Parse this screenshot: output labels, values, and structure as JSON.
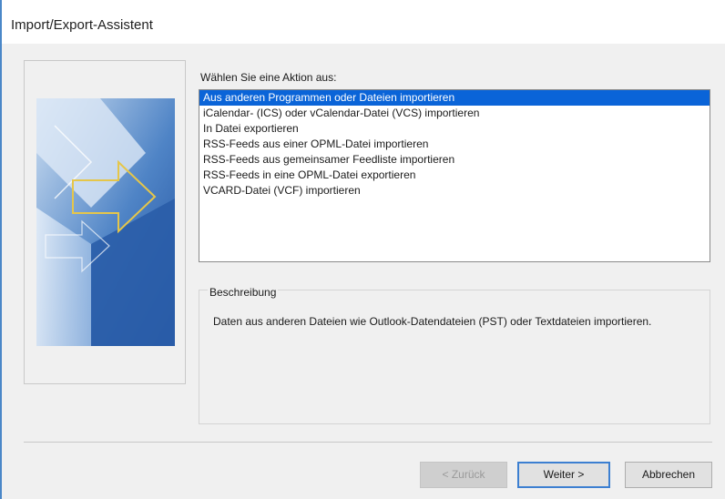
{
  "window": {
    "title": "Import/Export-Assistent"
  },
  "prompt": "Wählen Sie eine Aktion aus:",
  "actions": [
    {
      "label": "Aus anderen Programmen oder Dateien importieren",
      "selected": true
    },
    {
      "label": "iCalendar- (ICS) oder vCalendar-Datei (VCS) importieren",
      "selected": false
    },
    {
      "label": "In Datei exportieren",
      "selected": false
    },
    {
      "label": "RSS-Feeds aus einer OPML-Datei importieren",
      "selected": false
    },
    {
      "label": "RSS-Feeds aus gemeinsamer Feedliste importieren",
      "selected": false
    },
    {
      "label": "RSS-Feeds in eine OPML-Datei exportieren",
      "selected": false
    },
    {
      "label": "VCARD-Datei (VCF) importieren",
      "selected": false
    }
  ],
  "description": {
    "label": "Beschreibung",
    "text": "Daten aus anderen Dateien wie Outlook-Datendateien (PST) oder Textdateien importieren."
  },
  "buttons": {
    "back": "< Zurück",
    "next": "Weiter >",
    "cancel": "Abbrechen"
  },
  "colors": {
    "selection": "#0a64d8",
    "accent": "#4a87c8"
  }
}
